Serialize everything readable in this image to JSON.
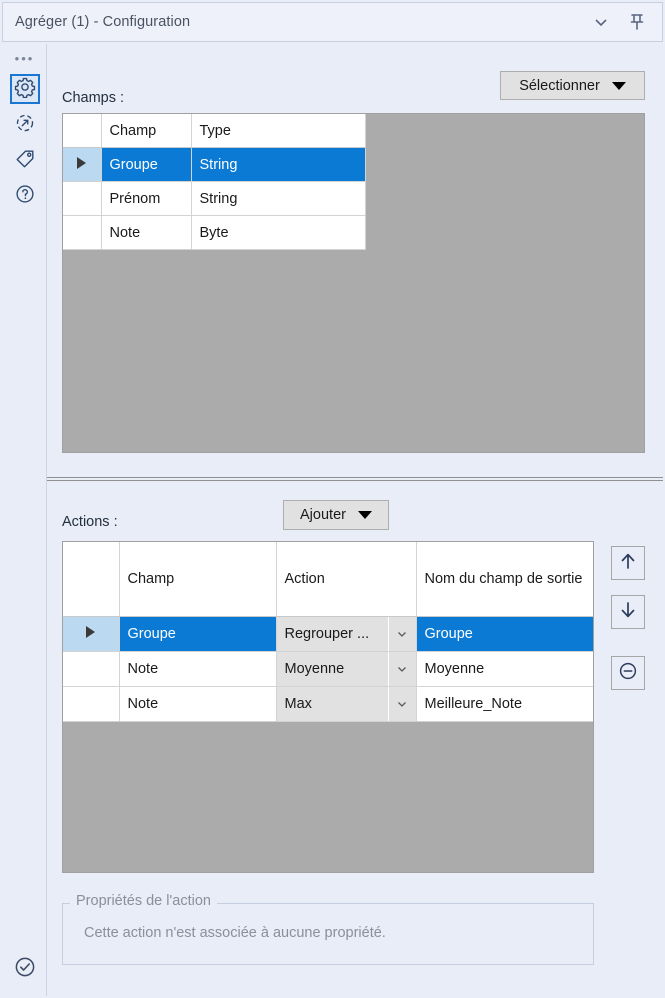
{
  "titlebar": {
    "title": "Agréger (1) - Configuration",
    "chevron_icon": "chevron-down-icon",
    "pin_icon": "pin-icon"
  },
  "rail": {
    "dots": "•••",
    "items": [
      {
        "icon": "gear-icon",
        "selected": true
      },
      {
        "icon": "refresh-arrow-icon",
        "selected": false
      },
      {
        "icon": "tag-icon",
        "selected": false
      },
      {
        "icon": "help-question-icon",
        "selected": false
      }
    ],
    "bottom_icon": "check-circle-icon"
  },
  "fields_section": {
    "label": "Champs :",
    "select_button": "Sélectionner",
    "columns": [
      "",
      "Champ",
      "Type"
    ],
    "rows": [
      {
        "selected": true,
        "champ": "Groupe",
        "type": "String"
      },
      {
        "selected": false,
        "champ": "Prénom",
        "type": "String"
      },
      {
        "selected": false,
        "champ": "Note",
        "type": "Byte"
      }
    ]
  },
  "actions_section": {
    "label": "Actions :",
    "add_button": "Ajouter",
    "columns": [
      "",
      "Champ",
      "Action",
      "Nom du champ de sortie"
    ],
    "rows": [
      {
        "selected": true,
        "champ": "Groupe",
        "action": "Regrouper ...",
        "output": "Groupe"
      },
      {
        "selected": false,
        "champ": "Note",
        "action": "Moyenne",
        "output": "Moyenne"
      },
      {
        "selected": false,
        "champ": "Note",
        "action": "Max",
        "output": "Meilleure_Note"
      }
    ],
    "buttons": [
      {
        "name": "move-up-button",
        "icon": "arrow-up-icon"
      },
      {
        "name": "move-down-button",
        "icon": "arrow-down-icon"
      },
      {
        "name": "remove-action-button",
        "icon": "minus-circle-icon"
      }
    ]
  },
  "properties_section": {
    "title": "Propriétés de l'action",
    "message": "Cette action n'est associée à aucune propriété."
  },
  "colors": {
    "background": "#e8edf7",
    "selection_blue": "#0a7ad4",
    "row_header_selected": "#bcd9f2",
    "grid_empty": "#ababab",
    "button_face": "#e1e1e1",
    "accent_border": "#1b76d2"
  }
}
